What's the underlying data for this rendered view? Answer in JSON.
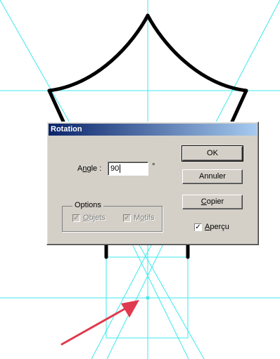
{
  "dialog": {
    "title": "Rotation",
    "angle_prefix": "A",
    "angle_u": "n",
    "angle_suffix": "gle :",
    "angle_value": "90",
    "degree_symbol": "°",
    "ok_label": "OK",
    "cancel_label": "Annuler",
    "copy_u": "C",
    "copy_rest": "opier",
    "options_legend": "Options",
    "objects_u": "O",
    "objects_rest": "bjets",
    "objects_checked": true,
    "objects_enabled": false,
    "patterns_prefix": "M",
    "patterns_u": "o",
    "patterns_rest": "tifs",
    "patterns_checked": true,
    "patterns_enabled": false,
    "preview_u": "A",
    "preview_rest": "perçu",
    "preview_checked": true
  },
  "colors": {
    "guide": "#3ee8ec",
    "shape_stroke": "#000000",
    "arrow": "#e03a4e",
    "titlebar_start": "#0a246a",
    "titlebar_end": "#a6caf0",
    "dialog_face": "#d4d0c8"
  }
}
